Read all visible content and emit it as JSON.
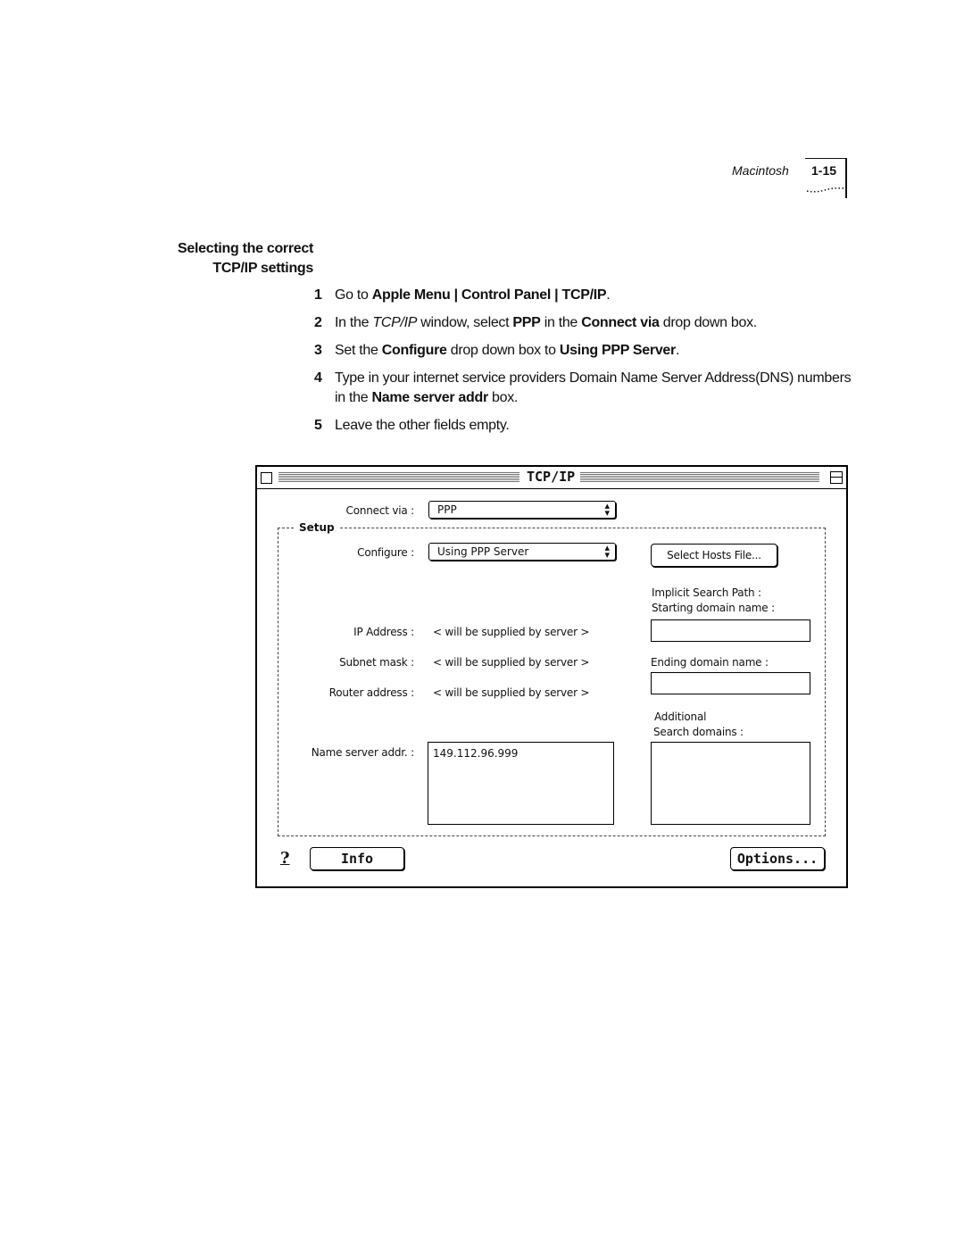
{
  "header": {
    "section": "Macintosh",
    "page": "1-15"
  },
  "section_title": {
    "line1": "Selecting the correct",
    "line2": "TCP/IP settings"
  },
  "steps": [
    {
      "num": "1",
      "parts": [
        {
          "t": "Go to "
        },
        {
          "b": "Apple Menu | Control Panel | TCP/IP"
        },
        {
          "t": "."
        }
      ]
    },
    {
      "num": "2",
      "parts": [
        {
          "t": "In the "
        },
        {
          "i": "TCP/IP"
        },
        {
          "t": " window, select "
        },
        {
          "b": "PPP"
        },
        {
          "t": " in the "
        },
        {
          "b": "Connect via"
        },
        {
          "t": " drop down box."
        }
      ]
    },
    {
      "num": "3",
      "parts": [
        {
          "t": "Set the "
        },
        {
          "b": "Configure"
        },
        {
          "t": " drop down box to "
        },
        {
          "b": "Using PPP Server"
        },
        {
          "t": "."
        }
      ]
    },
    {
      "num": "4",
      "parts": [
        {
          "t": "Type in your internet service providers Domain Name Server Address(DNS) numbers in the "
        },
        {
          "b": "Name server addr"
        },
        {
          "t": " box."
        }
      ]
    },
    {
      "num": "5",
      "parts": [
        {
          "t": "Leave the other fields empty."
        }
      ]
    }
  ],
  "window": {
    "title": "TCP/IP",
    "connect_via_label": "Connect via :",
    "connect_via_value": "PPP",
    "setup_label": "Setup",
    "configure_label": "Configure :",
    "configure_value": "Using PPP Server",
    "select_hosts_button": "Select Hosts File...",
    "ip_address_label": "IP Address :",
    "ip_address_value": "< will be supplied by server >",
    "subnet_mask_label": "Subnet mask :",
    "subnet_mask_value": "< will be supplied by server >",
    "router_address_label": "Router address :",
    "router_address_value": "< will be supplied by server >",
    "name_server_label": "Name server addr. :",
    "name_server_value": "149.112.96.999",
    "implicit_search_label1": "Implicit Search Path :",
    "implicit_search_label2": "Starting domain name :",
    "starting_domain_value": "",
    "ending_domain_label": "Ending domain name :",
    "ending_domain_value": "",
    "additional_label1": "Additional",
    "additional_label2": "Search domains :",
    "additional_value": "",
    "help_glyph": "?",
    "info_button": "Info",
    "options_button": "Options..."
  }
}
